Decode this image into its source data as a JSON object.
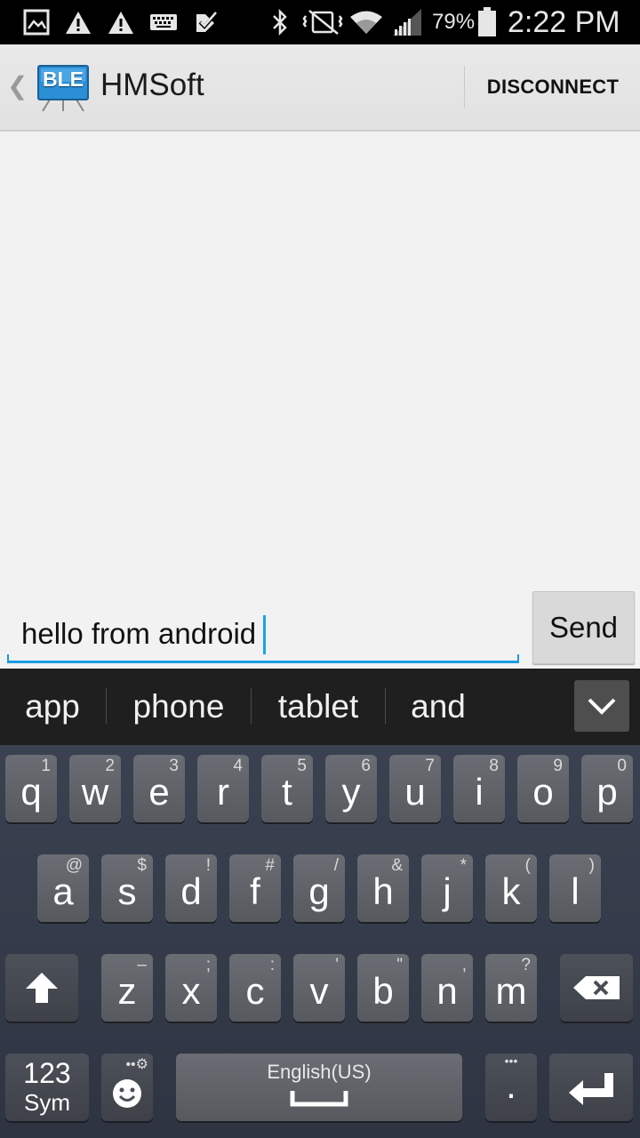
{
  "status_bar": {
    "battery_percent": "79%",
    "time": "2:22 PM",
    "icons": [
      "gallery-icon",
      "warning-icon",
      "warning-icon",
      "keyboard-icon",
      "task-check-icon",
      "bluetooth-icon",
      "mute-vibrate-icon",
      "wifi-icon",
      "signal-icon",
      "battery-icon"
    ]
  },
  "action_bar": {
    "app_icon_text": "BLE",
    "title": "HMSoft",
    "disconnect_label": "DISCONNECT"
  },
  "message_input": {
    "value": "hello from android",
    "accent_color": "#1a9be0"
  },
  "send_label": "Send",
  "suggestions": [
    "app",
    "phone",
    "tablet",
    "and"
  ],
  "keyboard": {
    "row1": [
      {
        "key": "q",
        "sec": "1"
      },
      {
        "key": "w",
        "sec": "2"
      },
      {
        "key": "e",
        "sec": "3"
      },
      {
        "key": "r",
        "sec": "4"
      },
      {
        "key": "t",
        "sec": "5"
      },
      {
        "key": "y",
        "sec": "6"
      },
      {
        "key": "u",
        "sec": "7"
      },
      {
        "key": "i",
        "sec": "8"
      },
      {
        "key": "o",
        "sec": "9"
      },
      {
        "key": "p",
        "sec": "0"
      }
    ],
    "row2": [
      {
        "key": "a",
        "sec": "@"
      },
      {
        "key": "s",
        "sec": "$"
      },
      {
        "key": "d",
        "sec": "!"
      },
      {
        "key": "f",
        "sec": "#"
      },
      {
        "key": "g",
        "sec": "/"
      },
      {
        "key": "h",
        "sec": "&"
      },
      {
        "key": "j",
        "sec": "*"
      },
      {
        "key": "k",
        "sec": "("
      },
      {
        "key": "l",
        "sec": ")"
      }
    ],
    "row3": [
      {
        "key": "z",
        "sec": "–"
      },
      {
        "key": "x",
        "sec": ";"
      },
      {
        "key": "c",
        "sec": ":"
      },
      {
        "key": "v",
        "sec": "'"
      },
      {
        "key": "b",
        "sec": "\""
      },
      {
        "key": "n",
        "sec": ","
      },
      {
        "key": "m",
        "sec": "?"
      }
    ],
    "sym_top": "123",
    "sym_bottom": "Sym",
    "space_label": "English(US)",
    "period_key": ".",
    "period_sec": "•••"
  }
}
